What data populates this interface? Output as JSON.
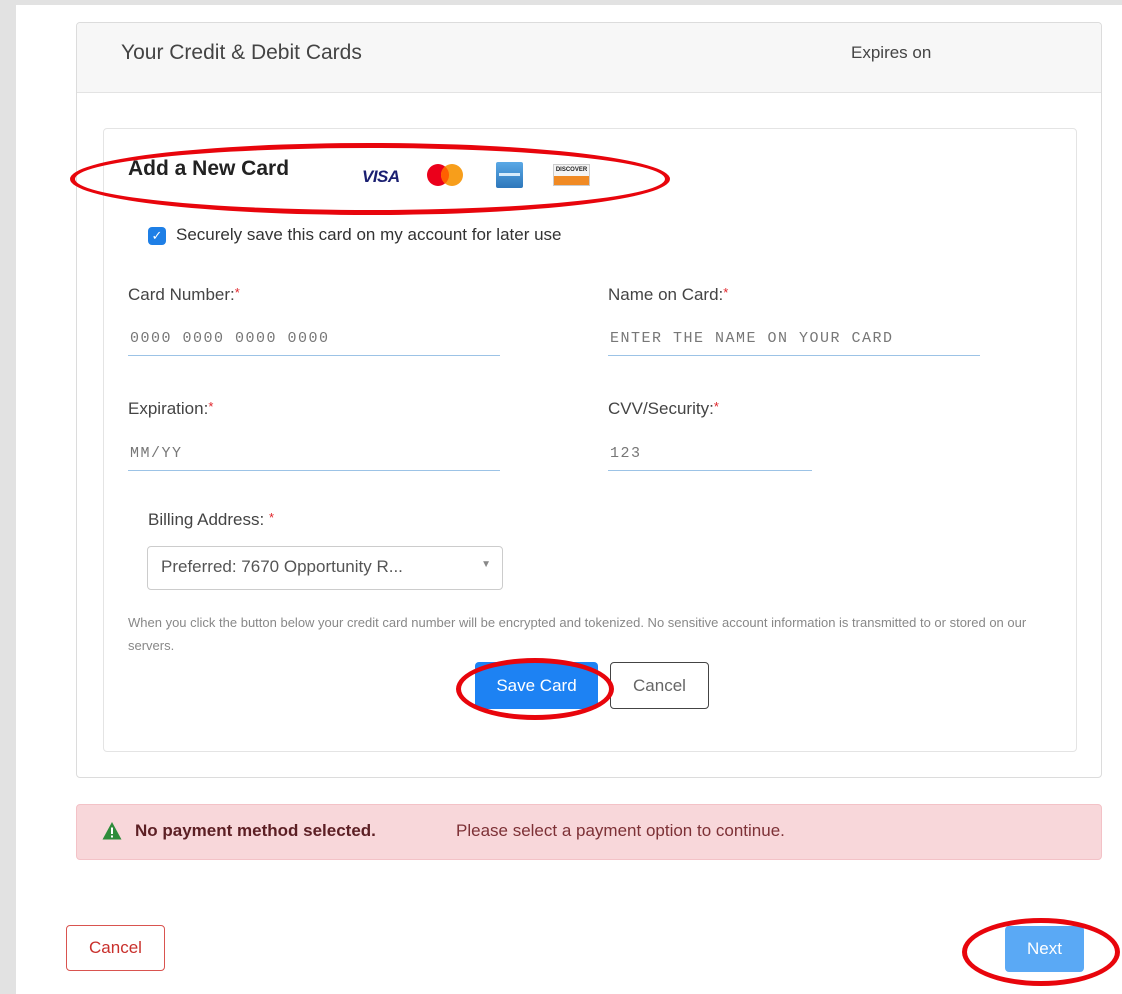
{
  "panel": {
    "title": "Your Credit & Debit Cards",
    "expires_label": "Expires on"
  },
  "add_card": {
    "title": "Add a New Card",
    "brand_logos": [
      "visa-logo",
      "mastercard-logo",
      "amex-logo",
      "discover-logo"
    ],
    "visa_text": "VISA",
    "discover_text": "DISCOVER",
    "save_checkbox": {
      "checked": true,
      "label": "Securely save this card on my account for later use"
    }
  },
  "form": {
    "required_mark": "*",
    "card_number": {
      "label": "Card Number:",
      "placeholder": "0000 0000 0000 0000"
    },
    "name_on_card": {
      "label": "Name on Card:",
      "placeholder": "ENTER THE NAME ON YOUR CARD"
    },
    "expiration": {
      "label": "Expiration:",
      "placeholder": "MM/YY"
    },
    "cvv": {
      "label": "CVV/Security:",
      "placeholder": "123"
    },
    "billing_address": {
      "label": "Billing Address:",
      "selected": "Preferred: 7670 Opportunity R..."
    }
  },
  "encryption_note": "When you click the button below your credit card number will be encrypted and tokenized. No sensitive account information is transmitted to or stored on our servers.",
  "buttons": {
    "save_card": "Save Card",
    "cancel_card": "Cancel",
    "cancel": "Cancel",
    "next": "Next"
  },
  "alert": {
    "strong": "No payment method selected.",
    "text": "Please select a payment option to continue."
  },
  "colors": {
    "primary": "#1d82f3",
    "next_button": "#5aa9f5",
    "alert_background": "#f8d7da",
    "annotation": "#e8050c",
    "alert_icon": "#2e8b3a"
  }
}
